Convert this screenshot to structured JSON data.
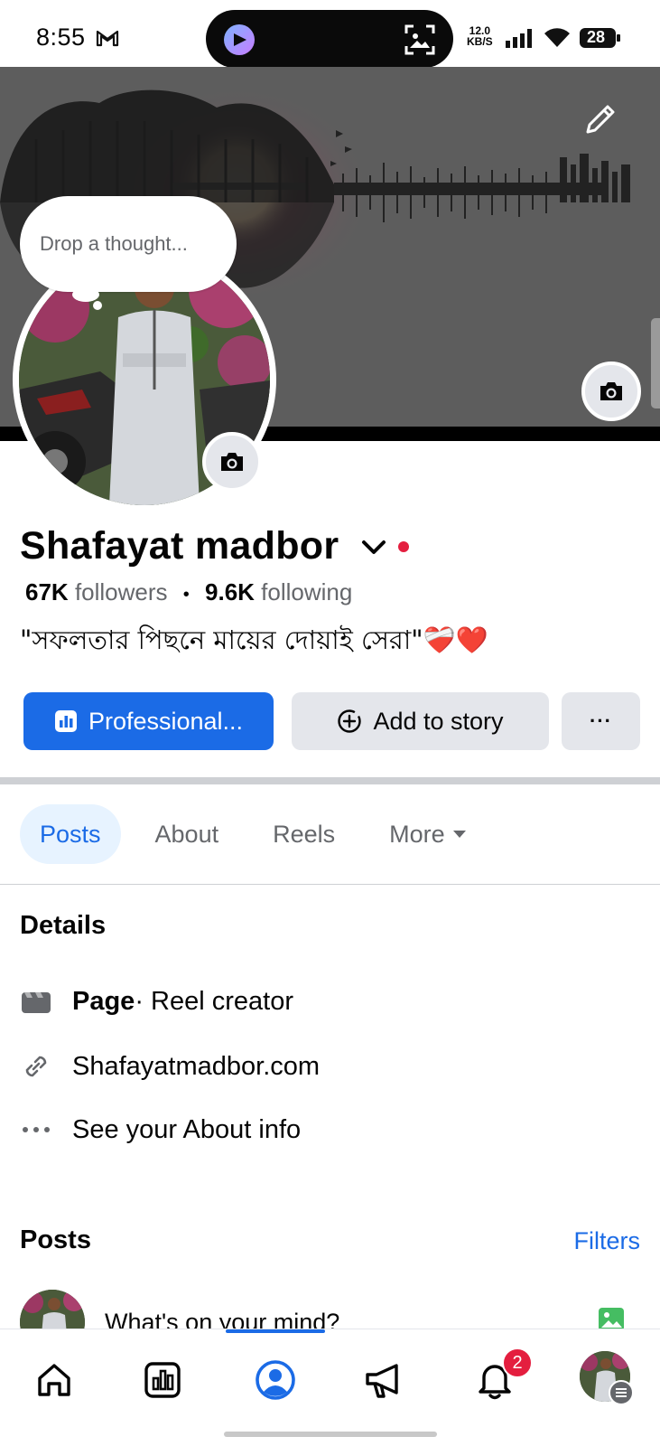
{
  "status_bar": {
    "time": "8:55",
    "speed_value": "12.0",
    "speed_unit": "KB/S",
    "battery": "28"
  },
  "profile": {
    "thought_placeholder": "Drop a thought...",
    "name": "Shafayat madbor",
    "followers_count": "67K",
    "followers_label": "followers",
    "separator": "•",
    "following_count": "9.6K",
    "following_label": "following",
    "bio": "\"সফলতার পিছনে  মায়ের দোয়াই সেরা\"❤️‍🩹❤️"
  },
  "actions": {
    "professional_label": "Professional...",
    "add_story_label": "Add to story",
    "more_label": "···"
  },
  "tabs": [
    {
      "label": "Posts",
      "active": true
    },
    {
      "label": "About",
      "active": false
    },
    {
      "label": "Reels",
      "active": false
    },
    {
      "label": "More",
      "active": false
    }
  ],
  "details": {
    "title": "Details",
    "page_label": "Page",
    "page_category": " · Reel creator",
    "website": "Shafayatmadbor.com",
    "about_info": "See your About info"
  },
  "posts": {
    "title": "Posts",
    "filters_label": "Filters",
    "composer_placeholder": "What's on your mind?"
  },
  "bottom_nav": {
    "notifications_badge": "2",
    "accent": "#1b6be6"
  }
}
